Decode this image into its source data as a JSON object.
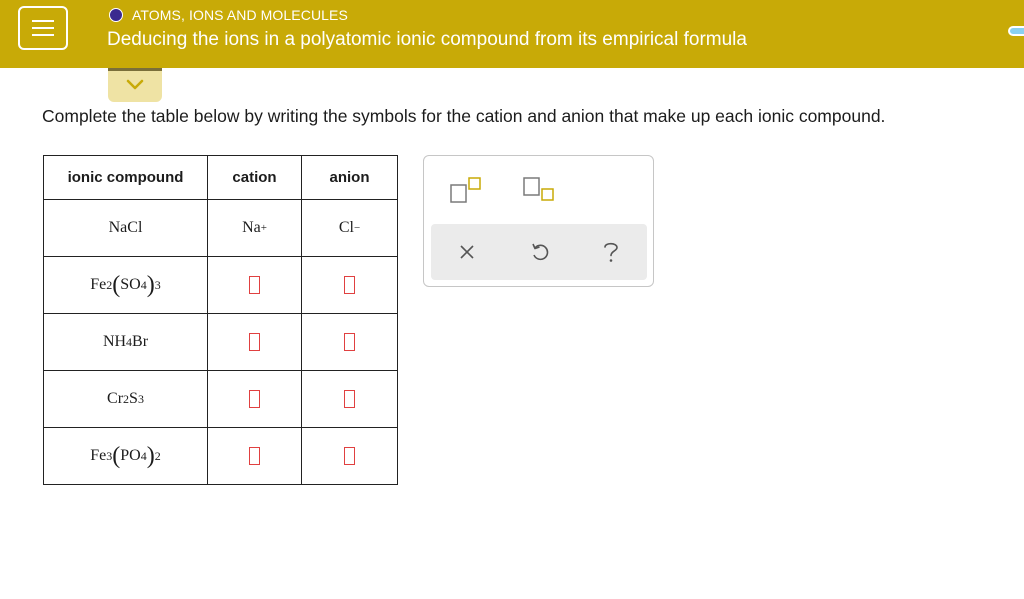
{
  "header": {
    "topic": "ATOMS, IONS AND MOLECULES",
    "title": "Deducing the ions in a polyatomic ionic compound from its empirical formula",
    "bg_color": "#c8aa07"
  },
  "icons": {
    "menu": "hamburger-menu-icon",
    "topic_status": "filled-circle-icon",
    "expand": "chevron-down-icon",
    "superscript_tool": "superscript-box-icon",
    "subscript_tool": "subscript-box-icon",
    "clear": "x-icon",
    "undo": "undo-icon",
    "help": "question-mark-icon"
  },
  "instruction": "Complete the table below by writing the symbols for the cation and anion that make up each ionic compound.",
  "table": {
    "headers": [
      "ionic compound",
      "cation",
      "anion"
    ],
    "rows": [
      {
        "compound": {
          "a": "NaCl"
        },
        "cation": {
          "symbol": "Na",
          "charge": "+"
        },
        "anion": {
          "symbol": "Cl",
          "charge": "−"
        }
      },
      {
        "compound": {
          "a": "Fe",
          "a_sub": "2",
          "group": "SO",
          "group_sub": "4",
          "group_mult": "3"
        },
        "cation": {
          "empty": true
        },
        "anion": {
          "empty": true
        }
      },
      {
        "compound": {
          "a": "NH",
          "a_sub": "4",
          "b": "Br"
        },
        "cation": {
          "empty": true
        },
        "anion": {
          "empty": true
        }
      },
      {
        "compound": {
          "a": "Cr",
          "a_sub": "2",
          "b": "S",
          "b_sub": "3"
        },
        "cation": {
          "empty": true
        },
        "anion": {
          "empty": true
        }
      },
      {
        "compound": {
          "a": "Fe",
          "a_sub": "3",
          "group": "PO",
          "group_sub": "4",
          "group_mult": "2"
        },
        "cation": {
          "empty": true
        },
        "anion": {
          "empty": true
        }
      }
    ]
  },
  "colors": {
    "empty_box_border": "#e04040",
    "tool_accent": "#c8aa07",
    "tool_gray": "#7a7a7a"
  }
}
